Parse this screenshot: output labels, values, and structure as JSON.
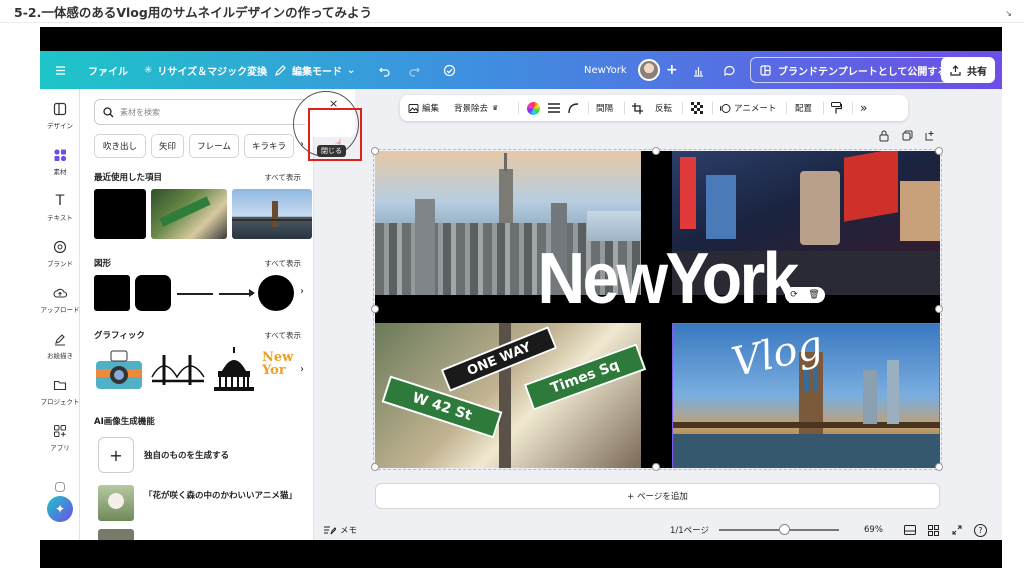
{
  "page": {
    "heading": "5-2.一体感のあるVlog用のサムネイルデザインの作ってみよう",
    "corner_glyph": "↘"
  },
  "topbar": {
    "menu_icon": "menu-icon",
    "file": "ファイル",
    "resize": "リサイズ＆マジック変換",
    "edit_mode": "編集モード",
    "doc_title": "NewYork",
    "publish": "ブランドテンプレートとして公開する",
    "share": "共有"
  },
  "rail": {
    "items": [
      "デザイン",
      "素材",
      "テキスト",
      "ブランド",
      "アップロード",
      "お絵描き",
      "プロジェクト",
      "アプリ"
    ]
  },
  "panel": {
    "search_placeholder": "素材を検索",
    "chips": [
      "吹き出し",
      "矢印",
      "フレーム",
      "キラキラ"
    ],
    "recent": {
      "title": "最近使用した項目",
      "more": "すべて表示"
    },
    "shapes": {
      "title": "図形",
      "more": "すべて表示"
    },
    "graphics": {
      "title": "グラフィック",
      "more": "すべて表示"
    },
    "ai": {
      "title": "AI画像生成機能",
      "create_own": "独自のものを生成する",
      "example": "「花が咲く森の中のかわいいアニメ猫」"
    }
  },
  "close_tab": {
    "glyph": "×",
    "tooltip": "閉じる"
  },
  "canvas_toolbar": {
    "edit": "編集",
    "bg_remove": "背景除去",
    "spacing": "間隔",
    "flip": "反転",
    "animate": "アニメート",
    "position": "配置"
  },
  "design": {
    "title_text": "NewYork",
    "script_text": "Vlog",
    "sign_one_way": "ONE WAY",
    "sign_w42": "W 42 St",
    "sign_times": "Times Sq"
  },
  "add_page": "+ ページを追加",
  "bottombar": {
    "notes": "メモ",
    "page_count": "1/1ページ",
    "zoom": "69%",
    "help": "?"
  },
  "colors": {
    "gradient_start": "#1ec5c9",
    "gradient_end": "#6d4ee6",
    "highlight_box": "#e0201b",
    "selection_purple": "#7d5cf0"
  }
}
